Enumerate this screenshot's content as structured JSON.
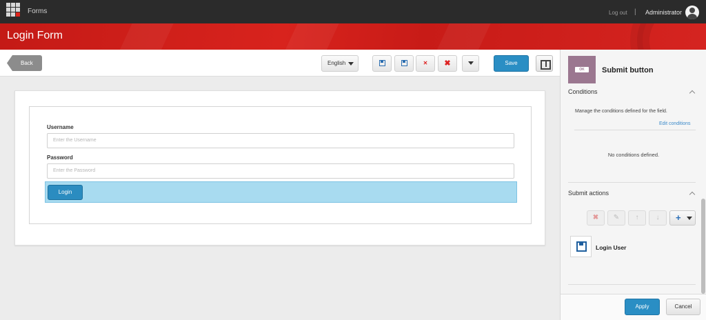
{
  "topbar": {
    "app_title": "Forms",
    "logout": "Log out",
    "separator": "|",
    "user": "Administrator"
  },
  "header": {
    "title": "Login Form"
  },
  "toolbar": {
    "back": "Back",
    "language": "English",
    "save": "Save",
    "icons": [
      "save-icon",
      "save-as-icon",
      "remove-icon",
      "delete-icon",
      "more-dropdown-icon"
    ]
  },
  "form": {
    "username_label": "Username",
    "username_placeholder": "Enter the Username",
    "password_label": "Password",
    "password_placeholder": "Enter the Password",
    "login_button": "Login"
  },
  "panel": {
    "thumb_text": "OK",
    "title": "Submit button",
    "conditions_title": "Conditions",
    "conditions_hint": "Manage the conditions defined for the field.",
    "edit_conditions": "Edit conditions",
    "no_conditions": "No conditions defined.",
    "submit_actions_title": "Submit actions",
    "action_item_label": "Login User",
    "apply": "Apply",
    "cancel": "Cancel"
  },
  "colors": {
    "header_red": "#d8231d",
    "primary_blue": "#2a8ec4",
    "selection_blue": "#a8dbf0",
    "thumb_purple": "#9b7790"
  }
}
